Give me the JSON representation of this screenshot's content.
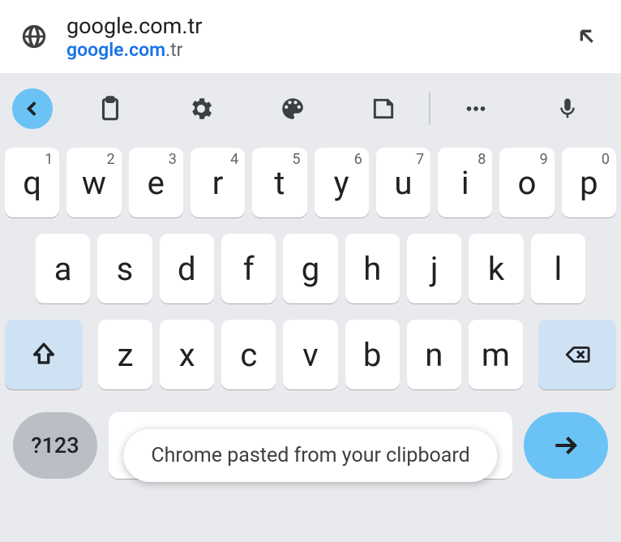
{
  "suggestion": {
    "line1": "google.com.tr",
    "line2_highlight": "google.com",
    "line2_rest": ".tr"
  },
  "toolbar": {
    "icons": [
      "chevron-left",
      "clipboard",
      "settings",
      "palette",
      "sticker",
      "more",
      "mic"
    ]
  },
  "keyboard": {
    "row1": [
      {
        "main": "q",
        "hint": "1"
      },
      {
        "main": "w",
        "hint": "2"
      },
      {
        "main": "e",
        "hint": "3"
      },
      {
        "main": "r",
        "hint": "4"
      },
      {
        "main": "t",
        "hint": "5"
      },
      {
        "main": "y",
        "hint": "6"
      },
      {
        "main": "u",
        "hint": "7"
      },
      {
        "main": "i",
        "hint": "8"
      },
      {
        "main": "o",
        "hint": "9"
      },
      {
        "main": "p",
        "hint": "0"
      }
    ],
    "row2": [
      "a",
      "s",
      "d",
      "f",
      "g",
      "h",
      "j",
      "k",
      "l"
    ],
    "row3": [
      "z",
      "x",
      "c",
      "v",
      "b",
      "n",
      "m"
    ],
    "symbols_label": "?123"
  },
  "toast": {
    "message": "Chrome pasted from your clipboard"
  },
  "colors": {
    "accent": "#6bc2f5",
    "link": "#1a73e8",
    "fn_key": "#cfe2f3"
  }
}
